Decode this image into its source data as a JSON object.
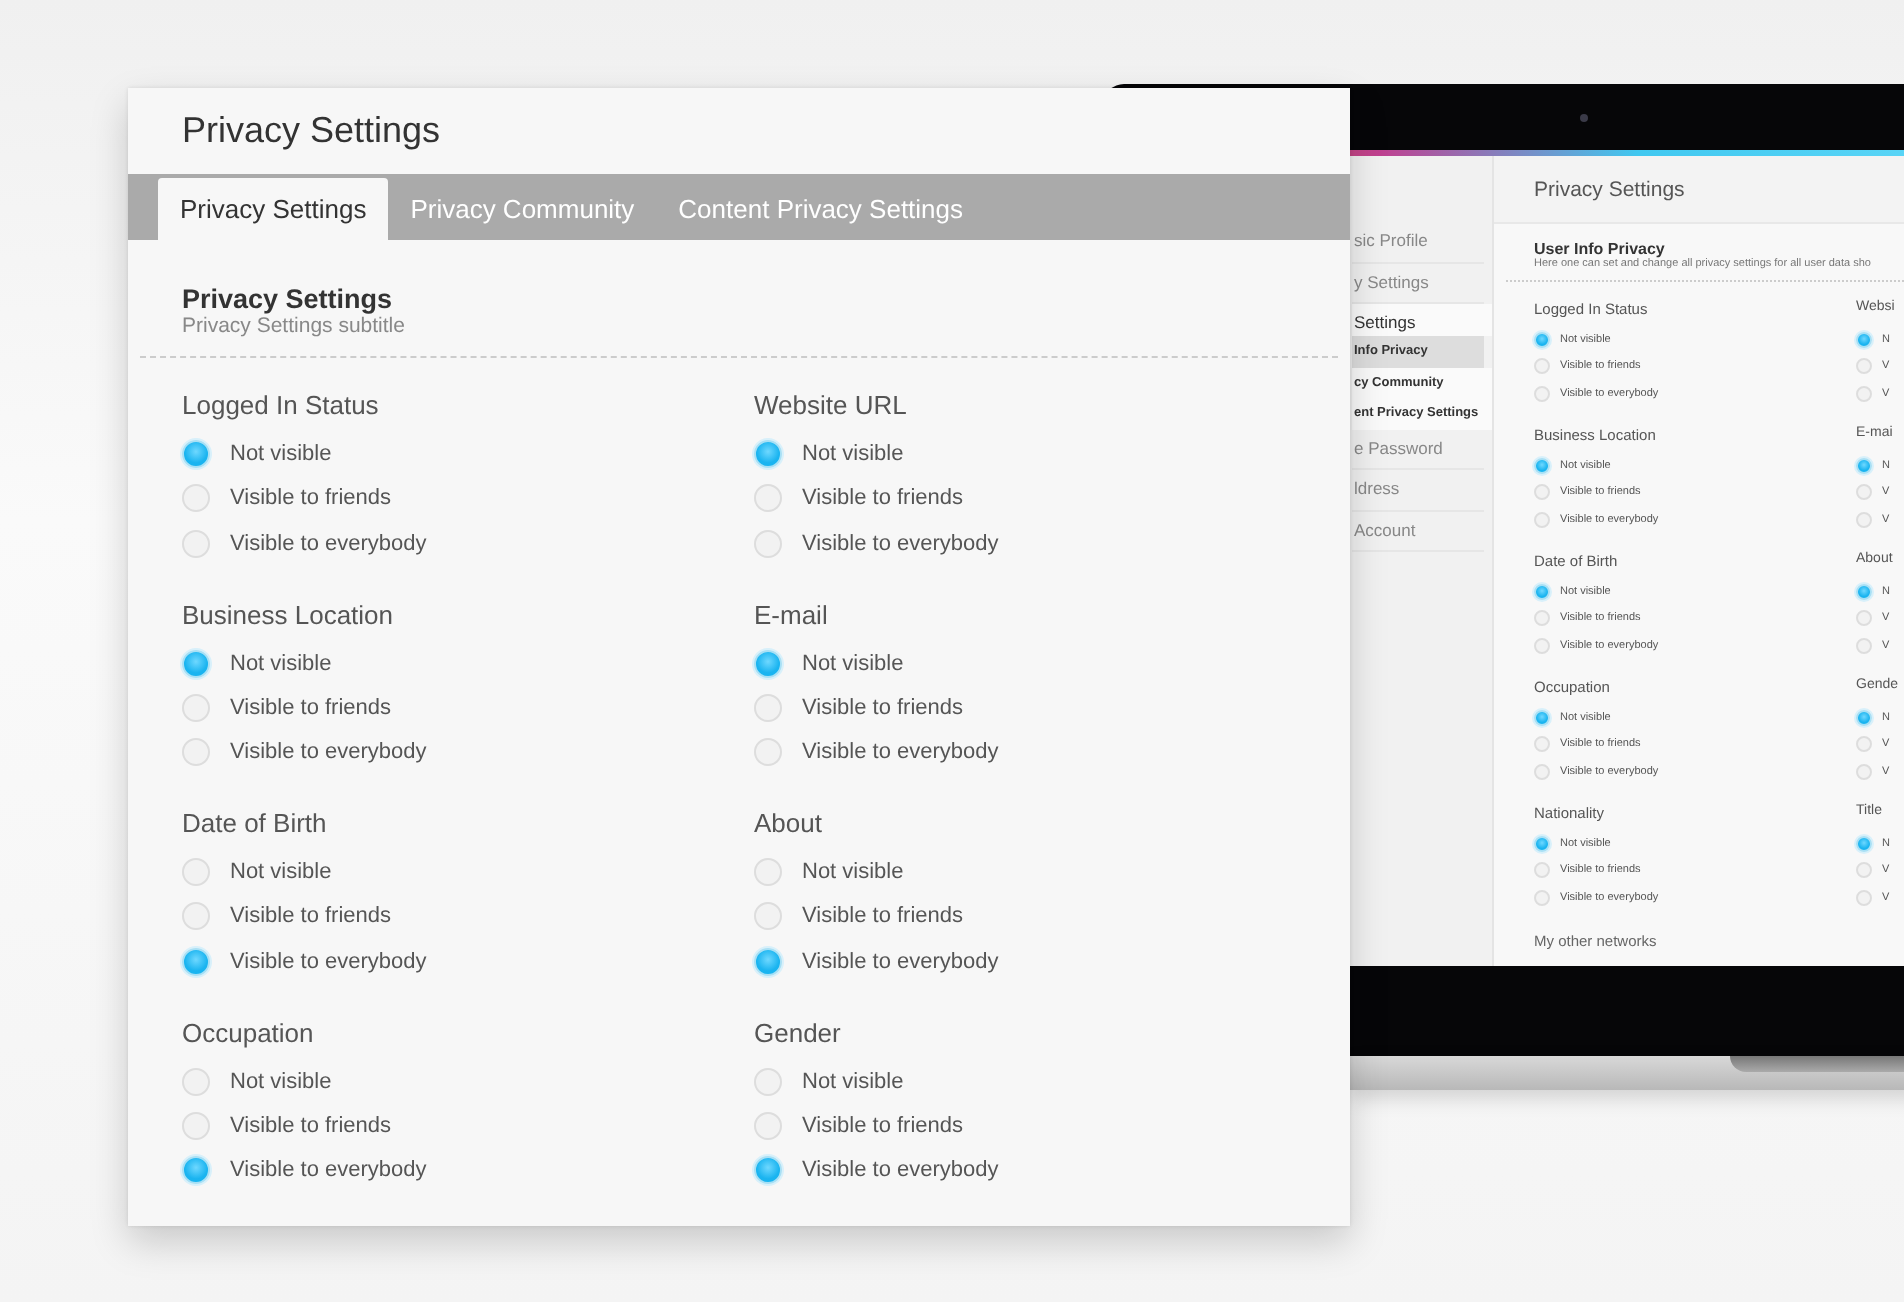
{
  "laptop": {
    "sidebar": [
      {
        "label": "sic Profile",
        "kind": "item",
        "selected": false
      },
      {
        "label": "y Settings",
        "kind": "item",
        "selected": false
      },
      {
        "label": "Settings",
        "kind": "header",
        "selected": false
      },
      {
        "label": "Info Privacy",
        "kind": "subitem",
        "selected": true
      },
      {
        "label": "cy Community",
        "kind": "subitem",
        "selected": false
      },
      {
        "label": "ent Privacy Settings",
        "kind": "subitem",
        "selected": false
      },
      {
        "label": "e Password",
        "kind": "item",
        "selected": false
      },
      {
        "label": "ldress",
        "kind": "item",
        "selected": false
      },
      {
        "label": "Account",
        "kind": "item",
        "selected": false
      }
    ],
    "header": "Privacy Settings",
    "section": {
      "title": "User Info Privacy",
      "subtitle": "Here one can set and change all privacy settings for all user data sho"
    },
    "columns": [
      [
        {
          "label": "Logged In Status",
          "options": [
            {
              "label": "Not visible",
              "selected": true
            },
            {
              "label": "Visible to friends",
              "selected": false
            },
            {
              "label": "Visible to everybody",
              "selected": false
            }
          ]
        },
        {
          "label": "Business Location",
          "options": [
            {
              "label": "Not visible",
              "selected": true
            },
            {
              "label": "Visible to friends",
              "selected": false
            },
            {
              "label": "Visible to everybody",
              "selected": false
            }
          ]
        },
        {
          "label": "Date of Birth",
          "options": [
            {
              "label": "Not visible",
              "selected": true
            },
            {
              "label": "Visible to friends",
              "selected": false
            },
            {
              "label": "Visible to everybody",
              "selected": false
            }
          ]
        },
        {
          "label": "Occupation",
          "options": [
            {
              "label": "Not visible",
              "selected": true
            },
            {
              "label": "Visible to friends",
              "selected": false
            },
            {
              "label": "Visible to everybody",
              "selected": false
            }
          ]
        },
        {
          "label": "Nationality",
          "options": [
            {
              "label": "Not visible",
              "selected": true
            },
            {
              "label": "Visible to friends",
              "selected": false
            },
            {
              "label": "Visible to everybody",
              "selected": false
            }
          ]
        }
      ],
      [
        {
          "label": "Websi",
          "options": [
            {
              "label": "N",
              "selected": true
            },
            {
              "label": "V",
              "selected": false
            },
            {
              "label": "V",
              "selected": false
            }
          ]
        },
        {
          "label": "E-mai",
          "options": [
            {
              "label": "N",
              "selected": true
            },
            {
              "label": "V",
              "selected": false
            },
            {
              "label": "V",
              "selected": false
            }
          ]
        },
        {
          "label": "About",
          "options": [
            {
              "label": "N",
              "selected": true
            },
            {
              "label": "V",
              "selected": false
            },
            {
              "label": "V",
              "selected": false
            }
          ]
        },
        {
          "label": "Gende",
          "options": [
            {
              "label": "N",
              "selected": true
            },
            {
              "label": "V",
              "selected": false
            },
            {
              "label": "V",
              "selected": false
            }
          ]
        },
        {
          "label": "Title",
          "options": [
            {
              "label": "N",
              "selected": true
            },
            {
              "label": "V",
              "selected": false
            },
            {
              "label": "V",
              "selected": false
            }
          ]
        }
      ]
    ],
    "footer": "My other networks"
  },
  "panel": {
    "title": "Privacy Settings",
    "tabs": [
      {
        "label": "Privacy Settings",
        "selected": true
      },
      {
        "label": "Privacy Community",
        "selected": false
      },
      {
        "label": "Content Privacy Settings",
        "selected": false
      }
    ],
    "section": {
      "title": "Privacy Settings",
      "subtitle": "Privacy Settings subtitle"
    },
    "columns": [
      [
        {
          "label": "Logged In Status",
          "options": [
            {
              "label": "Not visible",
              "selected": true
            },
            {
              "label": "Visible to friends",
              "selected": false
            },
            {
              "label": "Visible to everybody",
              "selected": false
            }
          ]
        },
        {
          "label": "Business Location",
          "options": [
            {
              "label": "Not visible",
              "selected": true
            },
            {
              "label": "Visible to friends",
              "selected": false
            },
            {
              "label": "Visible to everybody",
              "selected": false
            }
          ]
        },
        {
          "label": "Date of Birth",
          "options": [
            {
              "label": "Not visible",
              "selected": false
            },
            {
              "label": "Visible to friends",
              "selected": false
            },
            {
              "label": "Visible to everybody",
              "selected": true
            }
          ]
        },
        {
          "label": "Occupation",
          "options": [
            {
              "label": "Not visible",
              "selected": false
            },
            {
              "label": "Visible to friends",
              "selected": false
            },
            {
              "label": "Visible to everybody",
              "selected": true
            }
          ]
        }
      ],
      [
        {
          "label": "Website URL",
          "options": [
            {
              "label": "Not visible",
              "selected": true
            },
            {
              "label": "Visible to friends",
              "selected": false
            },
            {
              "label": "Visible to everybody",
              "selected": false
            }
          ]
        },
        {
          "label": "E-mail",
          "options": [
            {
              "label": "Not visible",
              "selected": true
            },
            {
              "label": "Visible to friends",
              "selected": false
            },
            {
              "label": "Visible to everybody",
              "selected": false
            }
          ]
        },
        {
          "label": "About",
          "options": [
            {
              "label": "Not visible",
              "selected": false
            },
            {
              "label": "Visible to friends",
              "selected": false
            },
            {
              "label": "Visible to everybody",
              "selected": true
            }
          ]
        },
        {
          "label": "Gender",
          "options": [
            {
              "label": "Not visible",
              "selected": false
            },
            {
              "label": "Visible to friends",
              "selected": false
            },
            {
              "label": "Visible to everybody",
              "selected": true
            }
          ]
        }
      ]
    ]
  }
}
